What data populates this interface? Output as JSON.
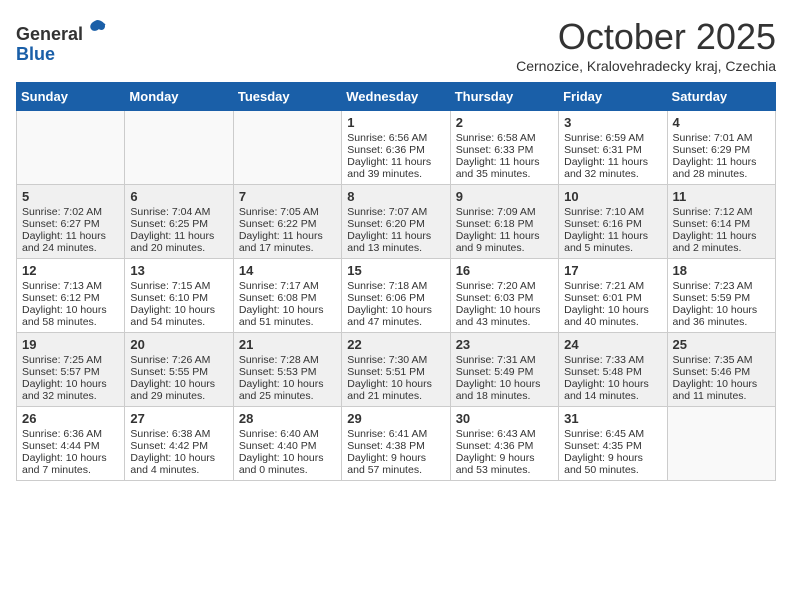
{
  "logo": {
    "general": "General",
    "blue": "Blue"
  },
  "header": {
    "month": "October 2025",
    "subtitle": "Cernozice, Kralovehradecky kraj, Czechia"
  },
  "weekdays": [
    "Sunday",
    "Monday",
    "Tuesday",
    "Wednesday",
    "Thursday",
    "Friday",
    "Saturday"
  ],
  "weeks": [
    [
      {
        "day": "",
        "info": ""
      },
      {
        "day": "",
        "info": ""
      },
      {
        "day": "",
        "info": ""
      },
      {
        "day": "1",
        "info": "Sunrise: 6:56 AM\nSunset: 6:36 PM\nDaylight: 11 hours\nand 39 minutes."
      },
      {
        "day": "2",
        "info": "Sunrise: 6:58 AM\nSunset: 6:33 PM\nDaylight: 11 hours\nand 35 minutes."
      },
      {
        "day": "3",
        "info": "Sunrise: 6:59 AM\nSunset: 6:31 PM\nDaylight: 11 hours\nand 32 minutes."
      },
      {
        "day": "4",
        "info": "Sunrise: 7:01 AM\nSunset: 6:29 PM\nDaylight: 11 hours\nand 28 minutes."
      }
    ],
    [
      {
        "day": "5",
        "info": "Sunrise: 7:02 AM\nSunset: 6:27 PM\nDaylight: 11 hours\nand 24 minutes."
      },
      {
        "day": "6",
        "info": "Sunrise: 7:04 AM\nSunset: 6:25 PM\nDaylight: 11 hours\nand 20 minutes."
      },
      {
        "day": "7",
        "info": "Sunrise: 7:05 AM\nSunset: 6:22 PM\nDaylight: 11 hours\nand 17 minutes."
      },
      {
        "day": "8",
        "info": "Sunrise: 7:07 AM\nSunset: 6:20 PM\nDaylight: 11 hours\nand 13 minutes."
      },
      {
        "day": "9",
        "info": "Sunrise: 7:09 AM\nSunset: 6:18 PM\nDaylight: 11 hours\nand 9 minutes."
      },
      {
        "day": "10",
        "info": "Sunrise: 7:10 AM\nSunset: 6:16 PM\nDaylight: 11 hours\nand 5 minutes."
      },
      {
        "day": "11",
        "info": "Sunrise: 7:12 AM\nSunset: 6:14 PM\nDaylight: 11 hours\nand 2 minutes."
      }
    ],
    [
      {
        "day": "12",
        "info": "Sunrise: 7:13 AM\nSunset: 6:12 PM\nDaylight: 10 hours\nand 58 minutes."
      },
      {
        "day": "13",
        "info": "Sunrise: 7:15 AM\nSunset: 6:10 PM\nDaylight: 10 hours\nand 54 minutes."
      },
      {
        "day": "14",
        "info": "Sunrise: 7:17 AM\nSunset: 6:08 PM\nDaylight: 10 hours\nand 51 minutes."
      },
      {
        "day": "15",
        "info": "Sunrise: 7:18 AM\nSunset: 6:06 PM\nDaylight: 10 hours\nand 47 minutes."
      },
      {
        "day": "16",
        "info": "Sunrise: 7:20 AM\nSunset: 6:03 PM\nDaylight: 10 hours\nand 43 minutes."
      },
      {
        "day": "17",
        "info": "Sunrise: 7:21 AM\nSunset: 6:01 PM\nDaylight: 10 hours\nand 40 minutes."
      },
      {
        "day": "18",
        "info": "Sunrise: 7:23 AM\nSunset: 5:59 PM\nDaylight: 10 hours\nand 36 minutes."
      }
    ],
    [
      {
        "day": "19",
        "info": "Sunrise: 7:25 AM\nSunset: 5:57 PM\nDaylight: 10 hours\nand 32 minutes."
      },
      {
        "day": "20",
        "info": "Sunrise: 7:26 AM\nSunset: 5:55 PM\nDaylight: 10 hours\nand 29 minutes."
      },
      {
        "day": "21",
        "info": "Sunrise: 7:28 AM\nSunset: 5:53 PM\nDaylight: 10 hours\nand 25 minutes."
      },
      {
        "day": "22",
        "info": "Sunrise: 7:30 AM\nSunset: 5:51 PM\nDaylight: 10 hours\nand 21 minutes."
      },
      {
        "day": "23",
        "info": "Sunrise: 7:31 AM\nSunset: 5:49 PM\nDaylight: 10 hours\nand 18 minutes."
      },
      {
        "day": "24",
        "info": "Sunrise: 7:33 AM\nSunset: 5:48 PM\nDaylight: 10 hours\nand 14 minutes."
      },
      {
        "day": "25",
        "info": "Sunrise: 7:35 AM\nSunset: 5:46 PM\nDaylight: 10 hours\nand 11 minutes."
      }
    ],
    [
      {
        "day": "26",
        "info": "Sunrise: 6:36 AM\nSunset: 4:44 PM\nDaylight: 10 hours\nand 7 minutes."
      },
      {
        "day": "27",
        "info": "Sunrise: 6:38 AM\nSunset: 4:42 PM\nDaylight: 10 hours\nand 4 minutes."
      },
      {
        "day": "28",
        "info": "Sunrise: 6:40 AM\nSunset: 4:40 PM\nDaylight: 10 hours\nand 0 minutes."
      },
      {
        "day": "29",
        "info": "Sunrise: 6:41 AM\nSunset: 4:38 PM\nDaylight: 9 hours\nand 57 minutes."
      },
      {
        "day": "30",
        "info": "Sunrise: 6:43 AM\nSunset: 4:36 PM\nDaylight: 9 hours\nand 53 minutes."
      },
      {
        "day": "31",
        "info": "Sunrise: 6:45 AM\nSunset: 4:35 PM\nDaylight: 9 hours\nand 50 minutes."
      },
      {
        "day": "",
        "info": ""
      }
    ]
  ]
}
